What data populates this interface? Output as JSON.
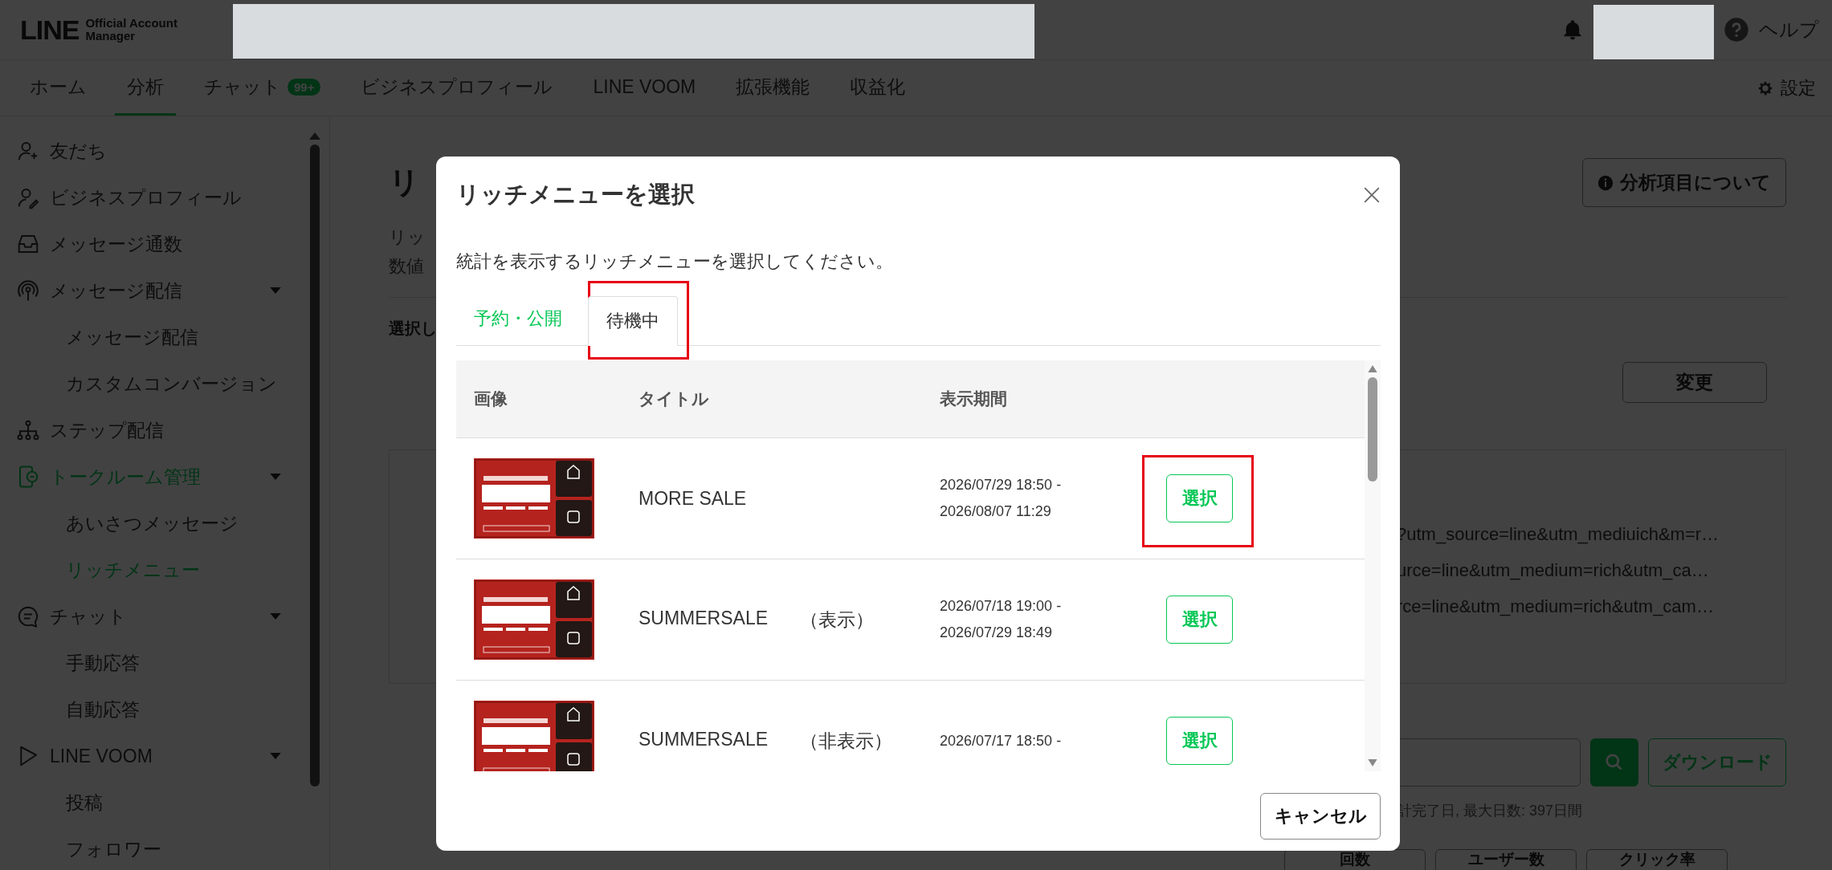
{
  "header": {
    "logo": "LINE",
    "logo_lines": [
      "Official Account",
      "Manager"
    ],
    "help": "ヘルプ"
  },
  "nav": {
    "items": [
      {
        "label": "ホーム",
        "selected": false
      },
      {
        "label": "分析",
        "selected": true
      },
      {
        "label": "チャット",
        "selected": false,
        "badge": "99+"
      },
      {
        "label": "ビジネスプロフィール",
        "selected": false
      },
      {
        "label": "LINE VOOM",
        "selected": false
      },
      {
        "label": "拡張機能",
        "selected": false
      },
      {
        "label": "収益化",
        "selected": false
      }
    ],
    "settings": "設定"
  },
  "sidebar": {
    "items": [
      {
        "label": "友だち",
        "selected": false
      },
      {
        "label": "ビジネスプロフィール",
        "selected": false
      },
      {
        "label": "メッセージ通数",
        "selected": false
      },
      {
        "label": "メッセージ配信",
        "selected": false,
        "expanded": true,
        "children": [
          {
            "label": "メッセージ配信",
            "selected": false
          },
          {
            "label": "カスタムコンバージョン",
            "selected": false
          }
        ]
      },
      {
        "label": "ステップ配信",
        "selected": false
      },
      {
        "label": "トークルーム管理",
        "selected": true,
        "expanded": true,
        "children": [
          {
            "label": "あいさつメッセージ",
            "selected": false
          },
          {
            "label": "リッチメニュー",
            "selected": true
          }
        ]
      },
      {
        "label": "チャット",
        "selected": false,
        "expanded": true,
        "children": [
          {
            "label": "手動応答",
            "selected": false
          },
          {
            "label": "自動応答",
            "selected": false
          }
        ]
      },
      {
        "label": "LINE VOOM",
        "selected": false,
        "expanded": true,
        "children": [
          {
            "label": "投稿",
            "selected": false
          },
          {
            "label": "フォロワー",
            "selected": false
          }
        ]
      }
    ]
  },
  "page": {
    "title": "リ",
    "description": [
      "リッ",
      "数値"
    ],
    "section_label": "選択し",
    "about_button": "分析項目について",
    "change_button": "変更",
    "urls": [
      "?utm_source=line&utm_mediuich&m=r…",
      "urce=line&utm_medium=rich&utm_ca…",
      "rce=line&utm_medium=rich&utm_cam…"
    ],
    "download_button": "ダウンロード",
    "note": "計完了日, 最大日数: 397日間",
    "metric_tabs": [
      "回数",
      "ユーザー数",
      "クリック率"
    ]
  },
  "modal": {
    "title": "リッチメニューを選択",
    "description": "統計を表示するリッチメニューを選択してください。",
    "tabs": [
      {
        "label": "予約・公開",
        "selected": false,
        "highlighted": false
      },
      {
        "label": "待機中",
        "selected": true,
        "highlighted": true
      }
    ],
    "columns": [
      "画像",
      "タイトル",
      "表示期間"
    ],
    "rows": [
      {
        "kind": "picture",
        "title": "MORE SALE",
        "period": [
          "2026/07/29 18:50 -",
          "2026/08/07 11:29"
        ],
        "button": "選択",
        "highlighted": true
      },
      {
        "kind": "picture",
        "title": "SUMMERSALE",
        "status": "（表示）",
        "period": [
          "2026/07/18 19:00 -",
          "2026/07/29 18:49"
        ],
        "button": "選択",
        "highlighted": false
      },
      {
        "kind": "picture",
        "title": "SUMMERSALE",
        "status": "（非表示）",
        "period": [
          "2026/07/17 18:50 -"
        ],
        "button": "選択",
        "highlighted": false
      }
    ],
    "cancel_button": "キャンセル"
  }
}
